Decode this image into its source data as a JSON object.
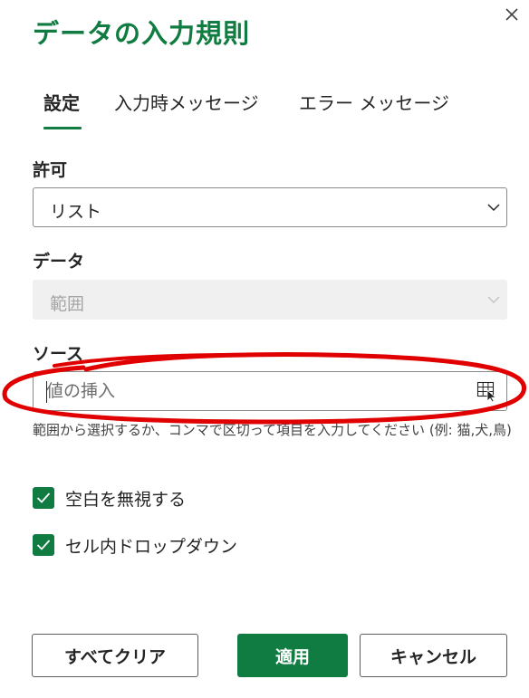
{
  "dialog": {
    "title": "データの入力規則",
    "close_icon": "close-icon"
  },
  "tabs": [
    {
      "label": "設定",
      "active": true
    },
    {
      "label": "入力時メッセージ",
      "active": false
    },
    {
      "label": "エラー メッセージ",
      "active": false
    }
  ],
  "allow": {
    "label": "許可",
    "value": "リスト"
  },
  "data_field": {
    "label": "データ",
    "value": "範囲",
    "disabled": true
  },
  "source": {
    "label": "ソース",
    "value": "",
    "placeholder": "値の挿入",
    "icon": "range-select-icon",
    "hint": "範囲から選択するか、コンマで区切って項目を入力してください (例: 猫,犬,鳥)"
  },
  "options": [
    {
      "label": "空白を無視する",
      "checked": true
    },
    {
      "label": "セル内ドロップダウン",
      "checked": true
    }
  ],
  "buttons": {
    "clear_all": "すべてクリア",
    "apply": "適用",
    "cancel": "キャンセル"
  },
  "colors": {
    "accent": "#107c41",
    "annotation": "#e00000"
  }
}
